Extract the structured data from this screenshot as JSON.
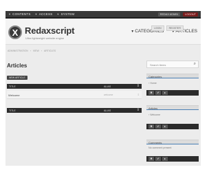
{
  "topbar": {
    "nav": [
      {
        "label": "CONTENTS"
      },
      {
        "label": "ACCESS"
      },
      {
        "label": "SYSTEM"
      }
    ],
    "profile_label": "REDAX ADMIN",
    "logout_label": "LOGOUT"
  },
  "header": {
    "brand": "Redaxscript",
    "tagline": "Ultra lightweight website engine",
    "nav": [
      {
        "label": "CATEGORIES"
      },
      {
        "label": "ARTICLES"
      }
    ]
  },
  "breadcrumb": [
    "ADMINISTRATION",
    "VIEW",
    "ARTICLES"
  ],
  "account": {
    "login_label": "LOGIN",
    "register_label": "REGISTER"
  },
  "main": {
    "title": "Articles",
    "new_button": "NEW ARTICLE",
    "table": {
      "col_title": "TITLE",
      "col_alias": "ALIAS",
      "rows": [
        {
          "title": "Welcome",
          "alias": "welcome"
        }
      ]
    }
  },
  "sidebar": {
    "search_placeholder": "Search items",
    "categories": {
      "title": "Categories",
      "items": [
        "Home"
      ]
    },
    "articles": {
      "title": "Articles",
      "items": [
        "Welcome"
      ]
    },
    "comments": {
      "title": "Comments",
      "text": "No comment present"
    }
  }
}
